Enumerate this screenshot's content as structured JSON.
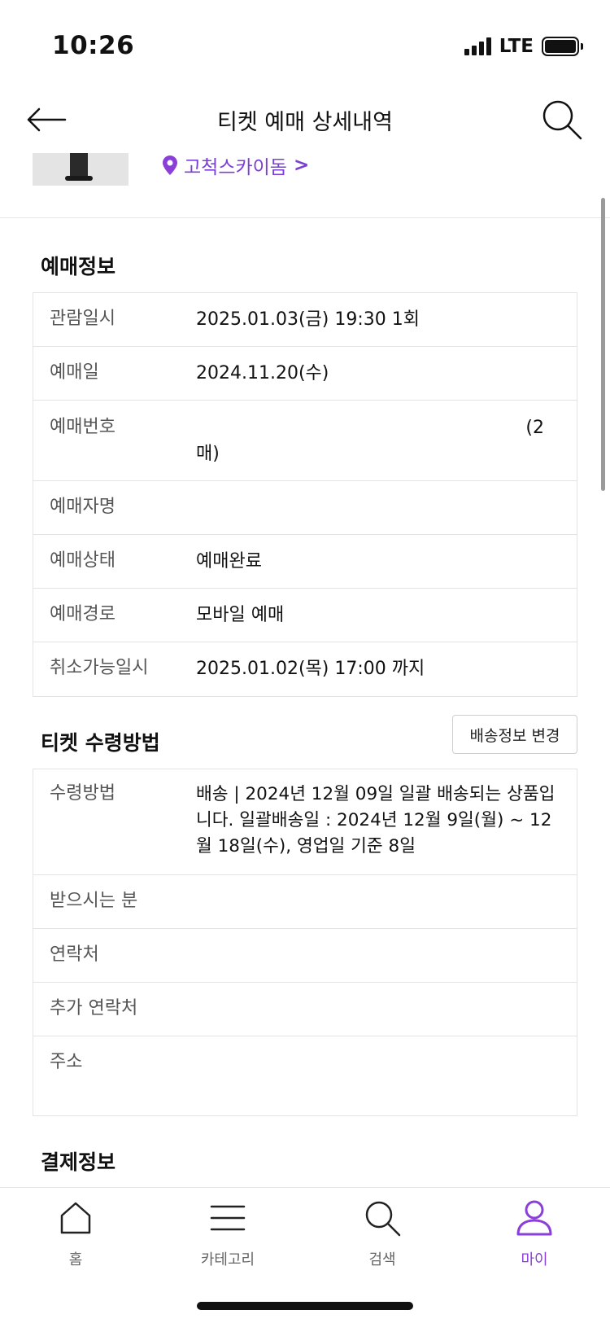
{
  "status_bar": {
    "time": "10:26",
    "network": "LTE"
  },
  "nav": {
    "title": "티켓 예매 상세내역",
    "back_icon": "arrow-left-icon",
    "search_icon": "search-icon"
  },
  "event": {
    "venue": "고척스카이돔",
    "venue_arrow": ">"
  },
  "booking_info": {
    "title": "예매정보",
    "rows": [
      {
        "label": "관람일시",
        "value": "2025.01.03(금) 19:30 1회"
      },
      {
        "label": "예매일",
        "value": "2024.11.20(수)"
      },
      {
        "label": "예매번호",
        "value": "(2",
        "value_line2": "매)"
      },
      {
        "label": "예매자명",
        "value": ""
      },
      {
        "label": "예매상태",
        "value": "예매완료"
      },
      {
        "label": "예매경로",
        "value": "모바일 예매"
      },
      {
        "label": "취소가능일시",
        "value": "2025.01.02(목) 17:00 까지"
      }
    ]
  },
  "ticket_receipt": {
    "title": "티켓 수령방법",
    "change_button": "배송정보 변경",
    "rows": [
      {
        "label": "수령방법",
        "value": "배송 | 2024년 12월 09일 일괄 배송되는 상품입니다. 일괄배송일 : 2024년 12월 9일(월) ~ 12월 18일(수), 영업일 기준 8일"
      },
      {
        "label": "받으시는 분",
        "value": ""
      },
      {
        "label": "연락처",
        "value": ""
      },
      {
        "label": "추가 연락처",
        "value": ""
      },
      {
        "label": "주소",
        "value": ""
      }
    ]
  },
  "payment_info": {
    "title": "결제정보"
  },
  "tab_bar": {
    "items": [
      {
        "label": "홈",
        "icon": "home-icon"
      },
      {
        "label": "카테고리",
        "icon": "menu-icon"
      },
      {
        "label": "검색",
        "icon": "search-icon"
      },
      {
        "label": "마이",
        "icon": "user-icon",
        "active": true
      }
    ]
  },
  "colors": {
    "accent": "#8a3fd8",
    "venue": "#7c3fd6",
    "border": "#e3e3e3"
  }
}
